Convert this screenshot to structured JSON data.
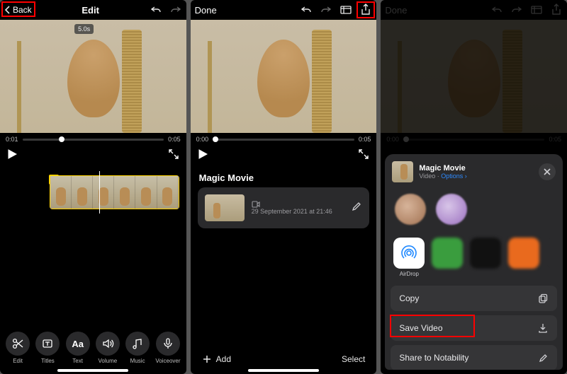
{
  "screen1": {
    "back": "Back",
    "title": "Edit",
    "clip_duration_chip": "5.0s",
    "time_start": "0:01",
    "time_end": "0:05",
    "timeline_badge": "T",
    "tools": [
      {
        "name": "edit",
        "label": "Edit"
      },
      {
        "name": "titles",
        "label": "Titles"
      },
      {
        "name": "text",
        "label": "Text",
        "glyph": "Aa"
      },
      {
        "name": "volume",
        "label": "Volume"
      },
      {
        "name": "music",
        "label": "Music"
      },
      {
        "name": "voiceover",
        "label": "Voiceover"
      }
    ]
  },
  "screen2": {
    "done": "Done",
    "time_start": "0:00",
    "time_end": "0:05",
    "section_title": "Magic Movie",
    "card_date": "29 September 2021 at 21:46",
    "add": "Add",
    "select": "Select"
  },
  "screen3": {
    "done": "Done",
    "time_start": "0:00",
    "time_end": "0:05",
    "sheet_title": "Magic Movie",
    "sheet_subtype": "Video",
    "options": "Options",
    "airdrop": "AirDrop",
    "actions": {
      "copy": "Copy",
      "save_video": "Save Video",
      "share_notability": "Share to Notability"
    }
  }
}
